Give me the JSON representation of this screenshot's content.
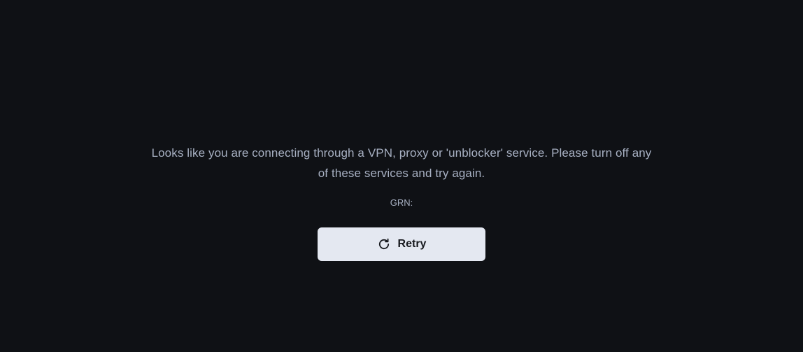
{
  "message": {
    "text": "Looks like you are connecting through a VPN, proxy or 'unblocker' service. Please turn off any of these services and try again."
  },
  "grn": {
    "label": "GRN:"
  },
  "retry": {
    "label": "Retry",
    "icon": "refresh-icon"
  },
  "colors": {
    "background": "#0f1115",
    "text": "#a7b0c2",
    "button_bg": "#e4e8f1",
    "button_text": "#16181d"
  }
}
